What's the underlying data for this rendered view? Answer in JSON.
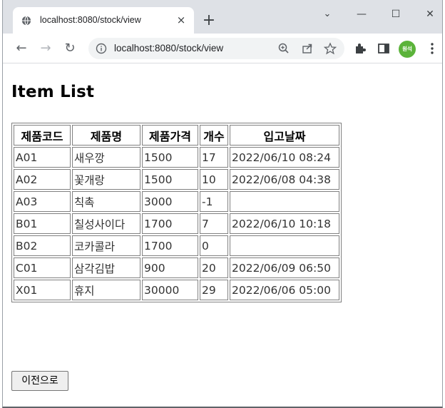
{
  "browser": {
    "tab": {
      "title": "localhost:8080/stock/view",
      "close_glyph": "×"
    },
    "new_tab_glyph": "+",
    "window_controls": {
      "tabsearch_glyph": "⌄",
      "minimize_glyph": "—",
      "maximize_glyph": "☐",
      "close_glyph": "✕"
    },
    "toolbar": {
      "back_glyph": "←",
      "forward_glyph": "→",
      "reload_glyph": "↻",
      "url": "localhost:8080/stock/view",
      "profile_label": "원석"
    },
    "icons": [
      "info-icon",
      "zoom-icon",
      "share-icon",
      "star-icon",
      "extensions-icon",
      "sidepanel-icon",
      "menu-icon"
    ]
  },
  "page": {
    "heading": "Item List",
    "table": {
      "columns": [
        "제품코드",
        "제품명",
        "제품가격",
        "개수",
        "입고날짜"
      ],
      "rows": [
        [
          "A01",
          "새우깡",
          "1500",
          "17",
          "2022/06/10 08:24"
        ],
        [
          "A02",
          "꽃개랑",
          "1500",
          "10",
          "2022/06/08 04:38"
        ],
        [
          "A03",
          "칙촉",
          "3000",
          "-1",
          ""
        ],
        [
          "B01",
          "칠성사이다",
          "1700",
          "7",
          "2022/06/10 10:18"
        ],
        [
          "B02",
          "코카콜라",
          "1700",
          "0",
          ""
        ],
        [
          "C01",
          "삼각김밥",
          "900",
          "20",
          "2022/06/09 06:50"
        ],
        [
          "X01",
          "휴지",
          "30000",
          "29",
          "2022/06/06 05:00"
        ]
      ]
    },
    "back_button_label": "이전으로"
  }
}
